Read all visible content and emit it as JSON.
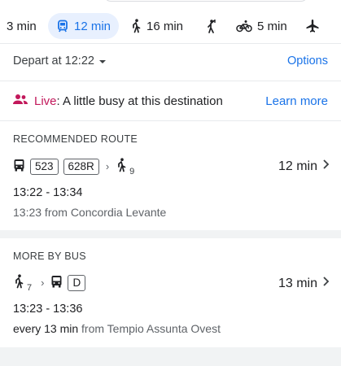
{
  "modes": [
    {
      "icon": "car-icon",
      "label": "3 min",
      "selected": false
    },
    {
      "icon": "transit-icon",
      "label": "12 min",
      "selected": true
    },
    {
      "icon": "walk-icon",
      "label": "16 min",
      "selected": false
    },
    {
      "icon": "ride-hail-icon",
      "label": "",
      "selected": false
    },
    {
      "icon": "bike-icon",
      "label": "5 min",
      "selected": false
    },
    {
      "icon": "flight-icon",
      "label": "",
      "selected": false
    }
  ],
  "depart": {
    "label": "Depart at 12:22",
    "options_label": "Options"
  },
  "live": {
    "label": "Live",
    "text": ": A little busy at this destination",
    "link": "Learn more",
    "accent": "#c2185b"
  },
  "recommended": {
    "title": "RECOMMENDED ROUTE",
    "lines": [
      "523",
      "628R"
    ],
    "walk_minutes": "9",
    "duration": "12 min",
    "times": "13:22 - 13:34",
    "from": "13:23 from Concordia Levante"
  },
  "more_bus": {
    "title": "MORE BY BUS",
    "walk_minutes": "7",
    "line": "D",
    "duration": "13 min",
    "times": "13:23 - 13:36",
    "frequency": "every 13 min",
    "from": " from Tempio Assunta Ovest"
  },
  "colors": {
    "accent": "#1a73e8",
    "selected_bg": "#e8f0fe",
    "muted": "#5f6368"
  }
}
